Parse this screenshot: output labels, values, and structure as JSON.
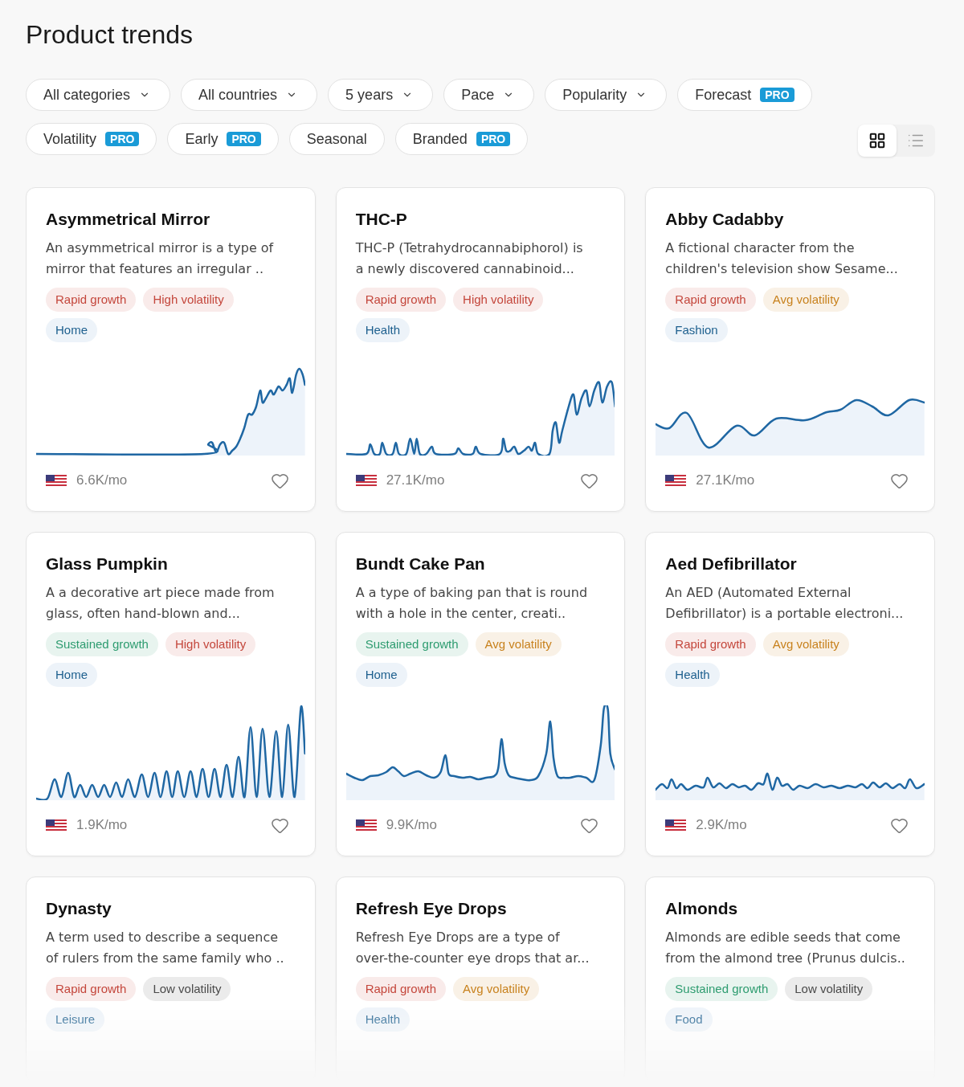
{
  "page": {
    "title": "Product trends"
  },
  "filter_rows": [
    [
      {
        "label": "All categories",
        "kind": "dropdown"
      },
      {
        "label": "All countries",
        "kind": "dropdown"
      },
      {
        "label": "5 years",
        "kind": "dropdown"
      },
      {
        "label": "Pace",
        "kind": "dropdown"
      },
      {
        "label": "Popularity",
        "kind": "dropdown"
      },
      {
        "label": "Forecast",
        "kind": "toggle",
        "badge": "PRO"
      }
    ],
    [
      {
        "label": "Volatility",
        "kind": "toggle",
        "badge": "PRO"
      },
      {
        "label": "Early",
        "kind": "toggle",
        "badge": "PRO"
      },
      {
        "label": "Seasonal",
        "kind": "toggle"
      },
      {
        "label": "Branded",
        "kind": "toggle",
        "badge": "PRO"
      }
    ]
  ],
  "view_toggle": [
    {
      "kind": "grid",
      "selected": true
    },
    {
      "kind": "list",
      "selected": false
    }
  ],
  "cards": [
    {
      "title": "Asymmetrical Mirror",
      "description": "An asymmetrical mirror is a type of\nmirror that features an irregular ..",
      "tags": [
        {
          "label": "Rapid growth",
          "color": "#c4473c"
        },
        {
          "label": "High volatility",
          "color": "#c4473c"
        }
      ],
      "category": "Home",
      "volume": "6.6K/mo",
      "saved": false
    },
    {
      "title": "THC-P",
      "description": "THC-P (Tetrahydrocannabiphorol) is\na newly discovered cannabinoid...",
      "tags": [
        {
          "label": "Rapid growth",
          "color": "#c4473c"
        },
        {
          "label": "High volatility",
          "color": "#c4473c"
        }
      ],
      "category": "Health",
      "volume": "27.1K/mo",
      "saved": false
    },
    {
      "title": "Abby Cadabby",
      "description": "A fictional character from the\nchildren's television show Sesame...",
      "tags": [
        {
          "label": "Rapid growth",
          "color": "#c4473c"
        },
        {
          "label": "Avg volatility",
          "color": "#c8821e"
        }
      ],
      "category": "Fashion",
      "volume": "27.1K/mo",
      "saved": false
    },
    {
      "title": "Glass Pumpkin",
      "description": "A a decorative art piece made from\nglass, often hand-blown and...",
      "tags": [
        {
          "label": "Sustained growth",
          "color": "#2e9c70"
        },
        {
          "label": "High volatility",
          "color": "#c4473c"
        }
      ],
      "category": "Home",
      "volume": "1.9K/mo",
      "saved": false
    },
    {
      "title": "Bundt Cake Pan",
      "description": "A a type of baking pan that is round\nwith a hole in the center, creati..",
      "tags": [
        {
          "label": "Sustained growth",
          "color": "#2e9c70"
        },
        {
          "label": "Avg volatility",
          "color": "#c8821e"
        }
      ],
      "category": "Home",
      "volume": "9.9K/mo",
      "saved": false
    },
    {
      "title": "Aed Defibrillator",
      "description": "An AED (Automated External\nDefibrillator) is a portable electroni...",
      "tags": [
        {
          "label": "Rapid growth",
          "color": "#c4473c"
        },
        {
          "label": "Avg volatility",
          "color": "#c8821e"
        }
      ],
      "category": "Health",
      "volume": "2.9K/mo",
      "saved": false
    },
    {
      "title": "Dynasty",
      "description": "A term used to describe a sequence\nof rulers from the same family who ..",
      "tags": [
        {
          "label": "Rapid growth",
          "color": "#c4473c"
        },
        {
          "label": "Low volatility",
          "color": "#4a4a4a"
        }
      ],
      "category": "Leisure"
    },
    {
      "title": "Refresh Eye Drops",
      "description": "Refresh Eye Drops are a type of\nover-the-counter eye drops that ar...",
      "tags": [
        {
          "label": "Rapid growth",
          "color": "#c4473c"
        },
        {
          "label": "Avg volatility",
          "color": "#c8821e"
        }
      ],
      "category": "Health"
    },
    {
      "title": "Almonds",
      "description": "Almonds are edible seeds that come\nfrom the almond tree (Prunus dulcis..",
      "tags": [
        {
          "label": "Sustained growth",
          "color": "#2e9c70"
        },
        {
          "label": "Low volatility",
          "color": "#4a4a4a"
        }
      ],
      "category": "Food"
    }
  ]
}
